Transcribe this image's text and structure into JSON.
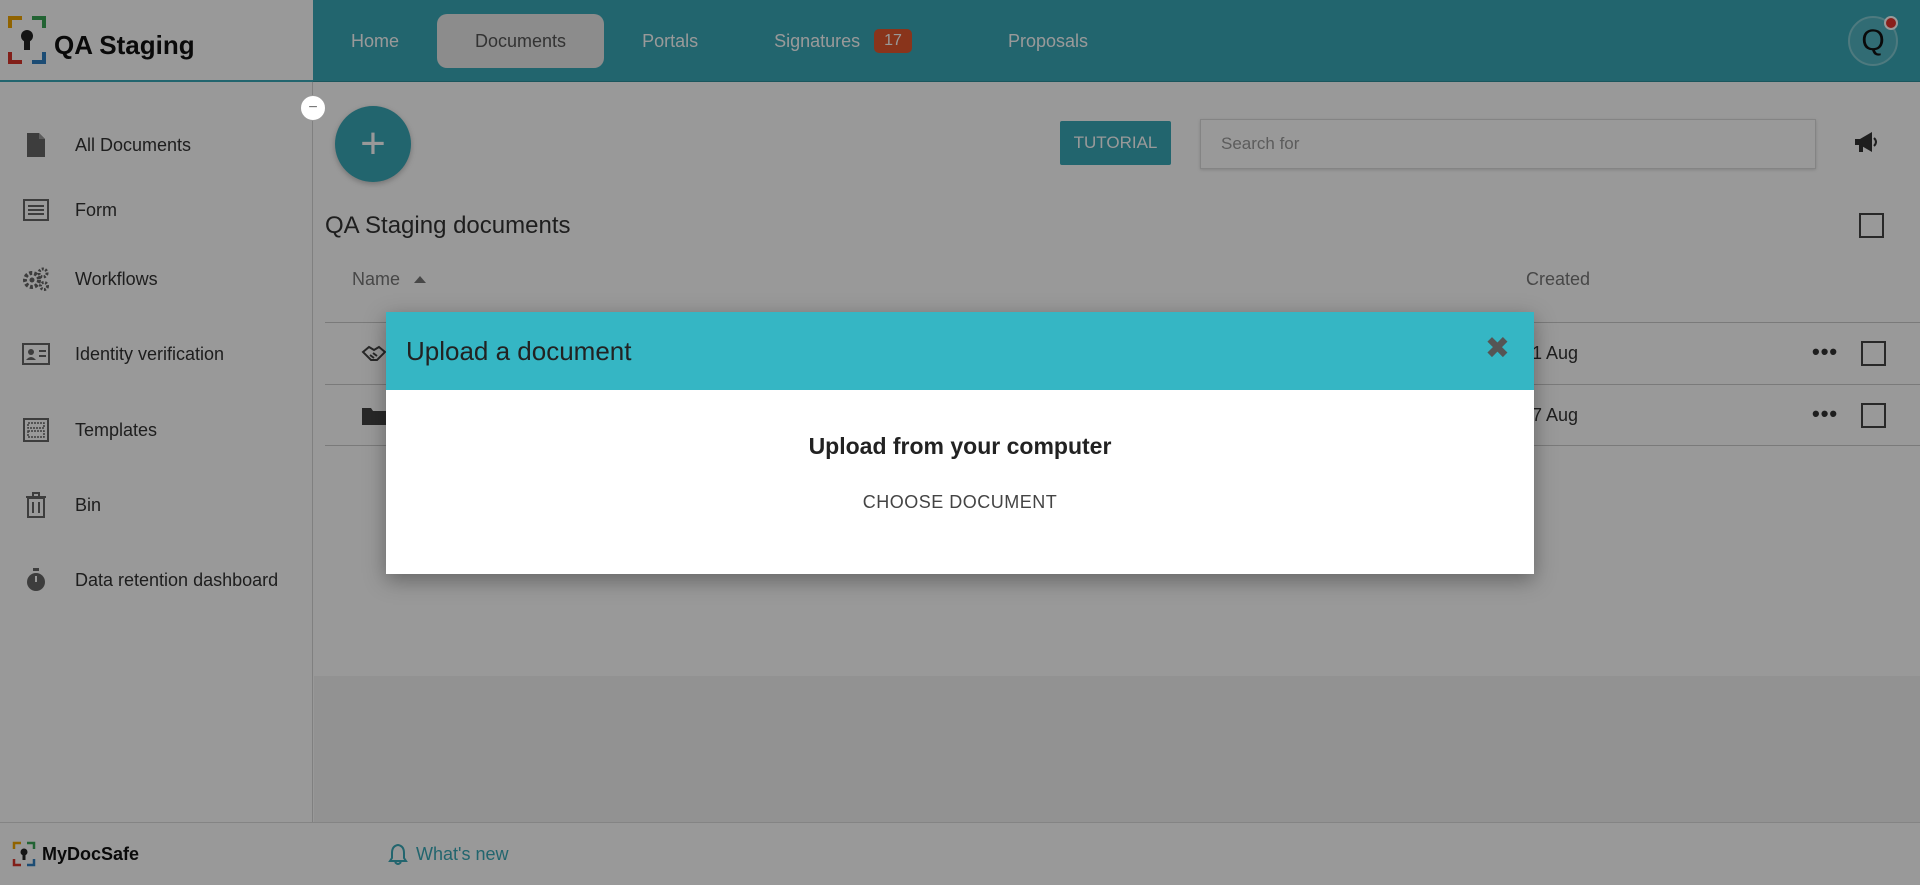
{
  "app": {
    "title": "QA Staging"
  },
  "nav": {
    "items": [
      {
        "label": "Home"
      },
      {
        "label": "Documents"
      },
      {
        "label": "Portals"
      },
      {
        "label": "Signatures",
        "badge": "17"
      },
      {
        "label": "Proposals"
      }
    ],
    "active": "Documents"
  },
  "user": {
    "avatar_initial": "Q"
  },
  "sidebar": {
    "collapse_symbol": "−",
    "items": [
      {
        "label": "All Documents",
        "icon": "file-icon"
      },
      {
        "label": "Form",
        "icon": "form-icon"
      },
      {
        "label": "Workflows",
        "icon": "gears-icon"
      },
      {
        "label": "Identity verification",
        "icon": "id-card-icon"
      },
      {
        "label": "Templates",
        "icon": "template-icon"
      },
      {
        "label": "Bin",
        "icon": "trash-icon"
      },
      {
        "label": "Data retention dashboard",
        "icon": "stopwatch-icon"
      }
    ]
  },
  "toolbar": {
    "add_symbol": "+",
    "tutorial_label": "TUTORIAL",
    "search_placeholder": "Search for"
  },
  "documents": {
    "title": "QA Staging documents",
    "columns": {
      "name": "Name",
      "created": "Created"
    },
    "rows": [
      {
        "icon": "handshake-icon",
        "created": "1 Aug",
        "more": "•••"
      },
      {
        "icon": "folder-icon",
        "created": "7 Aug",
        "more": "•••"
      }
    ]
  },
  "footer": {
    "brand": "MyDocSafe",
    "whats_new": "What's new"
  },
  "modal": {
    "title": "Upload a document",
    "close_symbol": "✖",
    "heading": "Upload from your computer",
    "choose_label": "CHOOSE DOCUMENT"
  },
  "colors": {
    "accent": "#39a9b7",
    "modal_header": "#35b6c4",
    "badge": "#e4572e"
  }
}
